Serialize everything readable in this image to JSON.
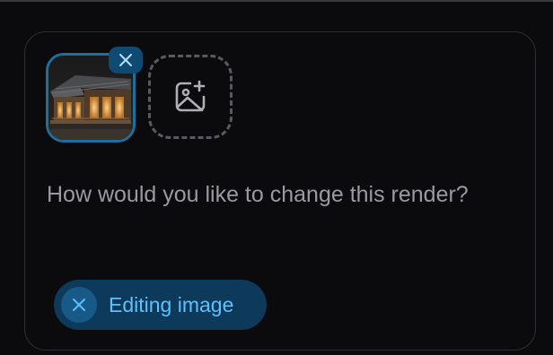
{
  "composer": {
    "attachments": [
      {
        "thumbnail_icon": "house-render-thumbnail",
        "remove_icon": "close-icon"
      }
    ],
    "add_image_icon": "add-image-icon",
    "prompt_placeholder": "How would you like to change this render?",
    "mode_chip": {
      "label": "Editing image",
      "remove_icon": "close-icon"
    }
  },
  "colors": {
    "background": "#0b0b0d",
    "panel_border": "#2f2f33",
    "accent": "#5cc0ff",
    "chip_background": "#0d3a5a",
    "placeholder_text": "#9a9aa0"
  }
}
